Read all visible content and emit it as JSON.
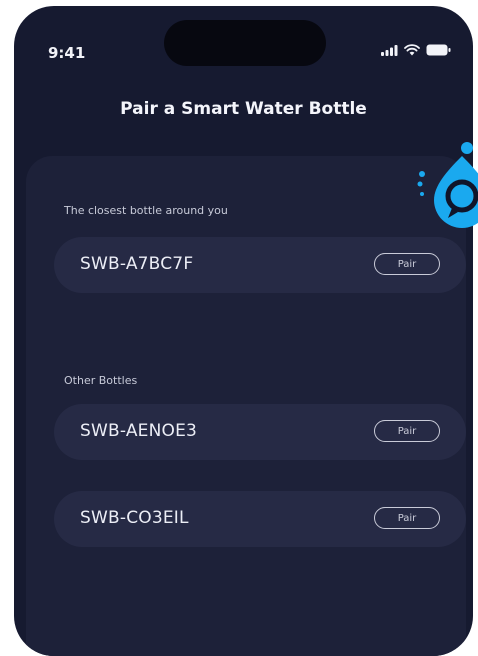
{
  "status_bar": {
    "time": "9:41"
  },
  "header": {
    "title": "Pair a Smart Water Bottle"
  },
  "closest_section": {
    "label": "The closest bottle around you",
    "devices": [
      {
        "name": "SWB-A7BC7F",
        "action": "Pair"
      }
    ]
  },
  "other_section": {
    "label": "Other  Bottles",
    "devices": [
      {
        "name": "SWB-AENOE3",
        "action": "Pair"
      },
      {
        "name": "SWB-CO3EIL",
        "action": "Pair"
      }
    ]
  },
  "icons": {
    "signal": "signal-bars-icon",
    "wifi": "wifi-icon",
    "battery": "battery-icon",
    "brand": "water-drop-logo-icon"
  },
  "colors": {
    "background": "#161a30",
    "card": "#1d2139",
    "row": "#262a45",
    "accent": "#1aa9ef"
  }
}
